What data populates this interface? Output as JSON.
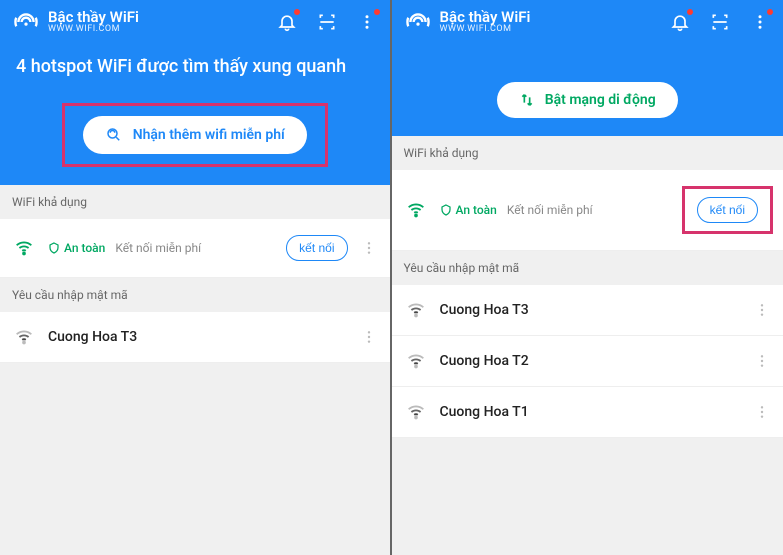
{
  "left": {
    "header": {
      "title": "Bậc thầy WiFi",
      "subtitle": "WWW.WIFI.COM",
      "hero": "4 hotspot WiFi được tìm thấy xung quanh",
      "cta": "Nhận thêm wifi miễn phí"
    },
    "sections": {
      "available": "WiFi khả dụng",
      "needpw": "Yêu cầu nhập mật mã"
    },
    "available": {
      "safe": "An toàn",
      "free": "Kết nối miễn phí",
      "connect": "kết nối"
    },
    "pwlist": [
      {
        "name": "Cuong Hoa T3"
      }
    ]
  },
  "right": {
    "header": {
      "title": "Bậc thầy WiFi",
      "subtitle": "WWW.WIFI.COM",
      "cta": "Bật mạng di động"
    },
    "sections": {
      "available": "WiFi khả dụng",
      "needpw": "Yêu cầu nhập mật mã"
    },
    "available": {
      "safe": "An toàn",
      "free": "Kết nối miễn phí",
      "connect": "kết nối"
    },
    "pwlist": [
      {
        "name": "Cuong Hoa T3"
      },
      {
        "name": "Cuong Hoa T2"
      },
      {
        "name": "Cuong Hoa T1"
      }
    ]
  }
}
